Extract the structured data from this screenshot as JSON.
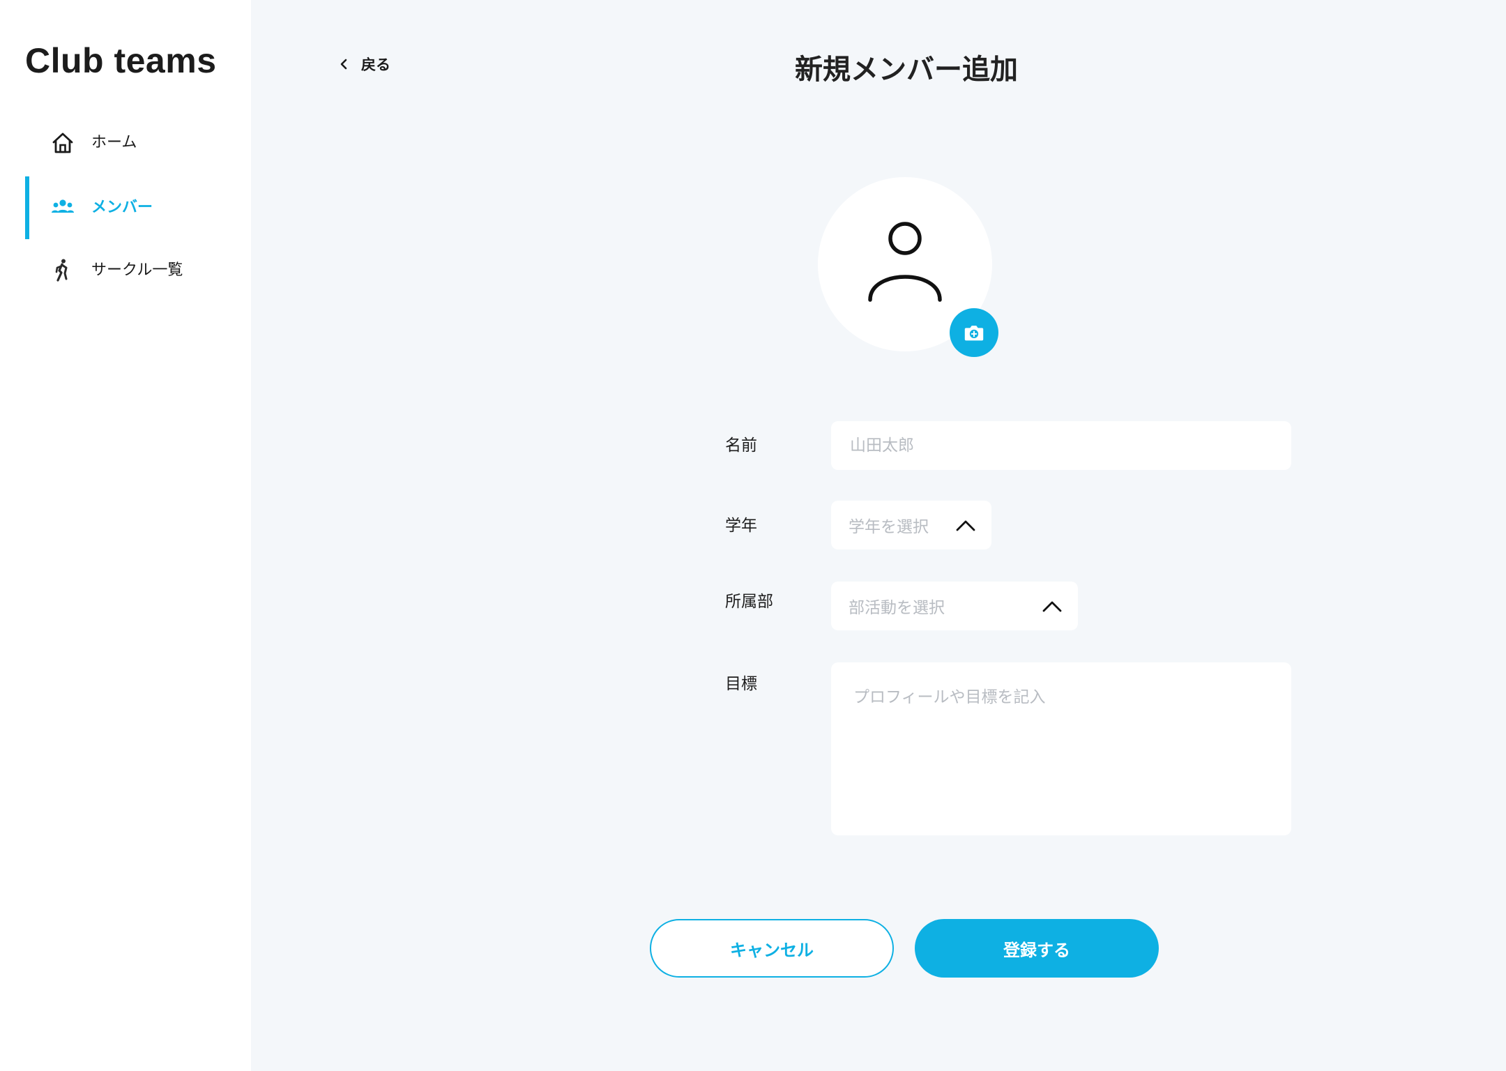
{
  "app": {
    "title": "Club teams"
  },
  "sidebar": {
    "items": [
      {
        "label": "ホーム",
        "icon": "home-icon",
        "active": false
      },
      {
        "label": "メンバー",
        "icon": "group-icon",
        "active": true
      },
      {
        "label": "サークル一覧",
        "icon": "runner-icon",
        "active": false
      }
    ]
  },
  "header": {
    "back_label": "戻る",
    "title": "新規メンバー追加"
  },
  "avatar": {
    "icon": "person-icon",
    "upload_icon": "camera-add-icon"
  },
  "form": {
    "name": {
      "label": "名前",
      "placeholder": "山田太郎"
    },
    "grade": {
      "label": "学年",
      "placeholder": "学年を選択"
    },
    "club": {
      "label": "所属部",
      "placeholder": "部活動を選択"
    },
    "goal": {
      "label": "目標",
      "placeholder": "プロフィールや目標を記入"
    }
  },
  "actions": {
    "cancel_label": "キャンセル",
    "submit_label": "登録する"
  },
  "colors": {
    "accent": "#0eb0e3",
    "background": "#f4f7fa",
    "surface": "#ffffff",
    "placeholder": "#b8bcc2"
  }
}
